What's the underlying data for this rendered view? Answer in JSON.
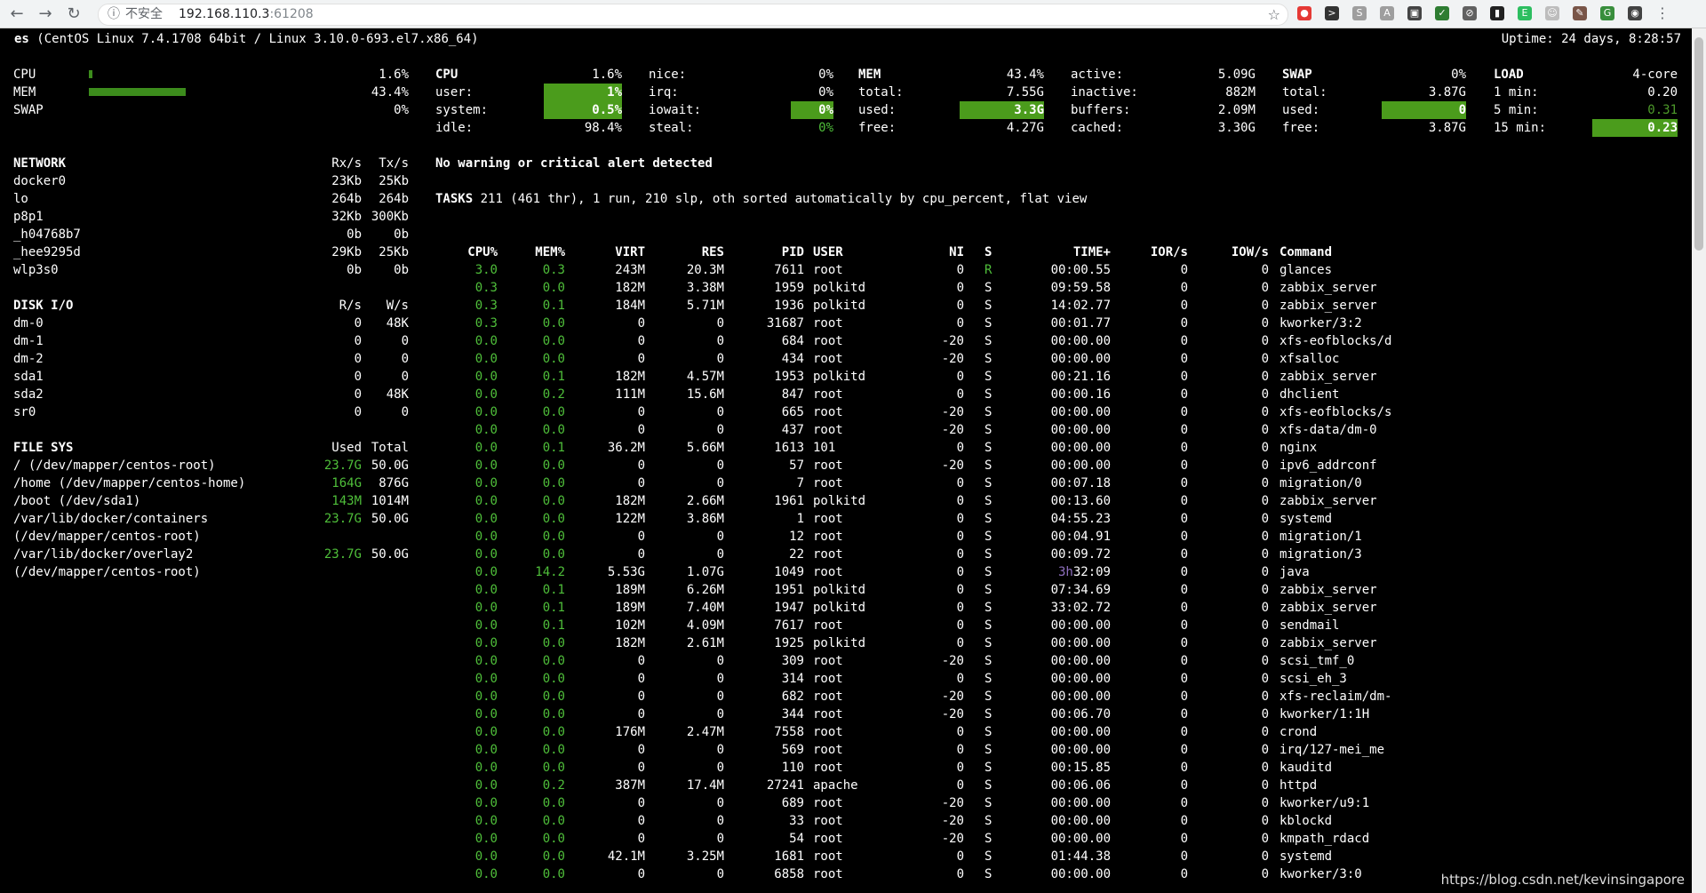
{
  "browser": {
    "back": "←",
    "forward": "→",
    "reload": "↻",
    "security_icon": "ⓘ",
    "security_text": "不安全",
    "url_host": "192.168.110.3",
    "url_port": ":61208",
    "star": "☆",
    "extensions": [
      {
        "icon": "stop-icon",
        "color": "#e53935",
        "glyph": "●"
      },
      {
        "icon": "terminal-icon",
        "color": "#333333",
        "glyph": ">"
      },
      {
        "icon": "s-icon",
        "color": "#9e9e9e",
        "glyph": "S"
      },
      {
        "icon": "a-icon",
        "color": "#9e9e9e",
        "glyph": "A"
      },
      {
        "icon": "card-icon",
        "color": "#444444",
        "glyph": "▣"
      },
      {
        "icon": "shield-icon",
        "color": "#2e7d32",
        "glyph": "✓"
      },
      {
        "icon": "block-icon",
        "color": "#616161",
        "glyph": "⊘"
      },
      {
        "icon": "bookmark-icon",
        "color": "#212121",
        "glyph": "▮"
      },
      {
        "icon": "evernote-icon",
        "color": "#2dbe60",
        "glyph": "E"
      },
      {
        "icon": "face-icon",
        "color": "#bdbdbd",
        "glyph": "☺"
      },
      {
        "icon": "paint-icon",
        "color": "#795548",
        "glyph": "✎"
      },
      {
        "icon": "g-icon",
        "color": "#388e3c",
        "glyph": "G"
      },
      {
        "icon": "avatar-icon",
        "color": "#424242",
        "glyph": "◉"
      },
      {
        "icon": "menu-icon",
        "color": "#f1f3f4",
        "glyph": "⋮"
      }
    ]
  },
  "header": {
    "host": "es",
    "system": "(CentOS Linux 7.4.1708 64bit / Linux 3.10.0-693.el7.x86_64)",
    "uptime": "Uptime: 24 days, 8:28:57"
  },
  "quicklook": {
    "rows": [
      {
        "label": "CPU",
        "value": "1.6%",
        "fraction": 0.016
      },
      {
        "label": "MEM",
        "value": "43.4%",
        "fraction": 0.434
      },
      {
        "label": "SWAP",
        "value": "0%",
        "fraction": 0
      }
    ]
  },
  "cpu": {
    "title": "CPU",
    "total": "1.6%",
    "rows": [
      {
        "label": "user:",
        "value": "1%"
      },
      {
        "label": "system:",
        "value": "0.5%"
      },
      {
        "label": "idle:",
        "value": "98.4%"
      }
    ],
    "rows2": [
      {
        "label": "nice:",
        "value": "0%"
      },
      {
        "label": "irq:",
        "value": "0%"
      },
      {
        "label": "iowait:",
        "value": "0%"
      },
      {
        "label": "steal:",
        "value": "0%"
      }
    ]
  },
  "mem": {
    "title": "MEM",
    "total_pct": "43.4%",
    "rows": [
      {
        "label": "total:",
        "value": "7.55G"
      },
      {
        "label": "used:",
        "value": "3.3G"
      },
      {
        "label": "free:",
        "value": "4.27G"
      }
    ],
    "rows2": [
      {
        "label": "active:",
        "value": "5.09G"
      },
      {
        "label": "inactive:",
        "value": "882M"
      },
      {
        "label": "buffers:",
        "value": "2.09M"
      },
      {
        "label": "cached:",
        "value": "3.30G"
      }
    ]
  },
  "swap": {
    "title": "SWAP",
    "pct": "0%",
    "rows": [
      {
        "label": "total:",
        "value": "3.87G"
      },
      {
        "label": "used:",
        "value": "0"
      },
      {
        "label": "free:",
        "value": "3.87G"
      }
    ]
  },
  "load": {
    "title": "LOAD",
    "cores": "4-core",
    "rows": [
      {
        "label": "1 min:",
        "value": "0.20"
      },
      {
        "label": "5 min:",
        "value": "0.31"
      },
      {
        "label": "15 min:",
        "value": "0.23"
      }
    ]
  },
  "network": {
    "title": "NETWORK",
    "rx": "Rx/s",
    "tx": "Tx/s",
    "rows": [
      {
        "name": "docker0",
        "rx": "23Kb",
        "tx": "25Kb"
      },
      {
        "name": "lo",
        "rx": "264b",
        "tx": "264b"
      },
      {
        "name": "p8p1",
        "rx": "32Kb",
        "tx": "300Kb"
      },
      {
        "name": "_h04768b7",
        "rx": "0b",
        "tx": "0b"
      },
      {
        "name": "_hee9295d",
        "rx": "29Kb",
        "tx": "25Kb"
      },
      {
        "name": "wlp3s0",
        "rx": "0b",
        "tx": "0b"
      }
    ]
  },
  "diskio": {
    "title": "DISK I/O",
    "r": "R/s",
    "w": "W/s",
    "rows": [
      {
        "name": "dm-0",
        "r": "0",
        "w": "48K"
      },
      {
        "name": "dm-1",
        "r": "0",
        "w": "0"
      },
      {
        "name": "dm-2",
        "r": "0",
        "w": "0"
      },
      {
        "name": "sda1",
        "r": "0",
        "w": "0"
      },
      {
        "name": "sda2",
        "r": "0",
        "w": "48K"
      },
      {
        "name": "sr0",
        "r": "0",
        "w": "0"
      }
    ]
  },
  "filesys": {
    "title": "FILE SYS",
    "used": "Used",
    "total": "Total",
    "rows": [
      {
        "name": "/ (/dev/mapper/centos-root)",
        "used": "23.7G",
        "total": "50.0G"
      },
      {
        "name": "/home (/dev/mapper/centos-home)",
        "used": "164G",
        "total": "876G"
      },
      {
        "name": "/boot (/dev/sda1)",
        "used": "143M",
        "total": "1014M"
      },
      {
        "name": "/var/lib/docker/containers",
        "used": "23.7G",
        "total": "50.0G"
      },
      {
        "name": "(/dev/mapper/centos-root)",
        "used": "",
        "total": ""
      },
      {
        "name": "/var/lib/docker/overlay2",
        "used": "23.7G",
        "total": "50.0G"
      },
      {
        "name": "(/dev/mapper/centos-root)",
        "used": "",
        "total": ""
      }
    ]
  },
  "alert": "No warning or critical alert detected",
  "tasks": {
    "label": "TASKS",
    "summary": "211 (461 thr), 1 run, 210 slp, oth sorted automatically by cpu_percent, flat view"
  },
  "processes": {
    "headers": [
      "CPU%",
      "MEM%",
      "VIRT",
      "RES",
      "PID",
      "USER",
      "NI",
      "S",
      "TIME+",
      "IOR/s",
      "IOW/s",
      "Command"
    ],
    "rows": [
      [
        "3.0",
        "0.3",
        "243M",
        "20.3M",
        "7611",
        "root",
        "0",
        "R",
        "00:00.55",
        "0",
        "0",
        "glances"
      ],
      [
        "0.3",
        "0.0",
        "182M",
        "3.38M",
        "1959",
        "polkitd",
        "0",
        "S",
        "09:59.58",
        "0",
        "0",
        "zabbix_server"
      ],
      [
        "0.3",
        "0.1",
        "184M",
        "5.71M",
        "1936",
        "polkitd",
        "0",
        "S",
        "14:02.77",
        "0",
        "0",
        "zabbix_server"
      ],
      [
        "0.3",
        "0.0",
        "0",
        "0",
        "31687",
        "root",
        "0",
        "S",
        "00:01.77",
        "0",
        "0",
        "kworker/3:2"
      ],
      [
        "0.0",
        "0.0",
        "0",
        "0",
        "684",
        "root",
        "-20",
        "S",
        "00:00.00",
        "0",
        "0",
        "xfs-eofblocks/d"
      ],
      [
        "0.0",
        "0.0",
        "0",
        "0",
        "434",
        "root",
        "-20",
        "S",
        "00:00.00",
        "0",
        "0",
        "xfsalloc"
      ],
      [
        "0.0",
        "0.1",
        "182M",
        "4.57M",
        "1953",
        "polkitd",
        "0",
        "S",
        "00:21.16",
        "0",
        "0",
        "zabbix_server"
      ],
      [
        "0.0",
        "0.2",
        "111M",
        "15.6M",
        "847",
        "root",
        "0",
        "S",
        "00:00.16",
        "0",
        "0",
        "dhclient"
      ],
      [
        "0.0",
        "0.0",
        "0",
        "0",
        "665",
        "root",
        "-20",
        "S",
        "00:00.00",
        "0",
        "0",
        "xfs-eofblocks/s"
      ],
      [
        "0.0",
        "0.0",
        "0",
        "0",
        "437",
        "root",
        "-20",
        "S",
        "00:00.00",
        "0",
        "0",
        "xfs-data/dm-0"
      ],
      [
        "0.0",
        "0.1",
        "36.2M",
        "5.66M",
        "1613",
        "101",
        "0",
        "S",
        "00:00.00",
        "0",
        "0",
        "nginx"
      ],
      [
        "0.0",
        "0.0",
        "0",
        "0",
        "57",
        "root",
        "-20",
        "S",
        "00:00.00",
        "0",
        "0",
        "ipv6_addrconf"
      ],
      [
        "0.0",
        "0.0",
        "0",
        "0",
        "7",
        "root",
        "0",
        "S",
        "00:07.18",
        "0",
        "0",
        "migration/0"
      ],
      [
        "0.0",
        "0.0",
        "182M",
        "2.66M",
        "1961",
        "polkitd",
        "0",
        "S",
        "00:13.60",
        "0",
        "0",
        "zabbix_server"
      ],
      [
        "0.0",
        "0.0",
        "122M",
        "3.86M",
        "1",
        "root",
        "0",
        "S",
        "04:55.23",
        "0",
        "0",
        "systemd"
      ],
      [
        "0.0",
        "0.0",
        "0",
        "0",
        "12",
        "root",
        "0",
        "S",
        "00:04.91",
        "0",
        "0",
        "migration/1"
      ],
      [
        "0.0",
        "0.0",
        "0",
        "0",
        "22",
        "root",
        "0",
        "S",
        "00:09.72",
        "0",
        "0",
        "migration/3"
      ],
      [
        "0.0",
        "14.2",
        "5.53G",
        "1.07G",
        "1049",
        "root",
        "0",
        "S",
        "3h32:09",
        "0",
        "0",
        "java"
      ],
      [
        "0.0",
        "0.1",
        "189M",
        "6.26M",
        "1951",
        "polkitd",
        "0",
        "S",
        "07:34.69",
        "0",
        "0",
        "zabbix_server"
      ],
      [
        "0.0",
        "0.1",
        "189M",
        "7.40M",
        "1947",
        "polkitd",
        "0",
        "S",
        "33:02.72",
        "0",
        "0",
        "zabbix_server"
      ],
      [
        "0.0",
        "0.1",
        "102M",
        "4.09M",
        "7617",
        "root",
        "0",
        "S",
        "00:00.00",
        "0",
        "0",
        "sendmail"
      ],
      [
        "0.0",
        "0.0",
        "182M",
        "2.61M",
        "1925",
        "polkitd",
        "0",
        "S",
        "00:00.00",
        "0",
        "0",
        "zabbix_server"
      ],
      [
        "0.0",
        "0.0",
        "0",
        "0",
        "309",
        "root",
        "-20",
        "S",
        "00:00.00",
        "0",
        "0",
        "scsi_tmf_0"
      ],
      [
        "0.0",
        "0.0",
        "0",
        "0",
        "314",
        "root",
        "0",
        "S",
        "00:00.00",
        "0",
        "0",
        "scsi_eh_3"
      ],
      [
        "0.0",
        "0.0",
        "0",
        "0",
        "682",
        "root",
        "-20",
        "S",
        "00:00.00",
        "0",
        "0",
        "xfs-reclaim/dm-"
      ],
      [
        "0.0",
        "0.0",
        "0",
        "0",
        "344",
        "root",
        "-20",
        "S",
        "00:06.70",
        "0",
        "0",
        "kworker/1:1H"
      ],
      [
        "0.0",
        "0.0",
        "176M",
        "2.47M",
        "7558",
        "root",
        "0",
        "S",
        "00:00.00",
        "0",
        "0",
        "crond"
      ],
      [
        "0.0",
        "0.0",
        "0",
        "0",
        "569",
        "root",
        "0",
        "S",
        "00:00.00",
        "0",
        "0",
        "irq/127-mei_me"
      ],
      [
        "0.0",
        "0.0",
        "0",
        "0",
        "110",
        "root",
        "0",
        "S",
        "00:15.85",
        "0",
        "0",
        "kauditd"
      ],
      [
        "0.0",
        "0.2",
        "387M",
        "17.4M",
        "27241",
        "apache",
        "0",
        "S",
        "00:06.06",
        "0",
        "0",
        "httpd"
      ],
      [
        "0.0",
        "0.0",
        "0",
        "0",
        "689",
        "root",
        "-20",
        "S",
        "00:00.00",
        "0",
        "0",
        "kworker/u9:1"
      ],
      [
        "0.0",
        "0.0",
        "0",
        "0",
        "33",
        "root",
        "-20",
        "S",
        "00:00.00",
        "0",
        "0",
        "kblockd"
      ],
      [
        "0.0",
        "0.0",
        "0",
        "0",
        "54",
        "root",
        "-20",
        "S",
        "00:00.00",
        "0",
        "0",
        "kmpath_rdacd"
      ],
      [
        "0.0",
        "0.0",
        "42.1M",
        "3.25M",
        "1681",
        "root",
        "0",
        "S",
        "01:44.38",
        "0",
        "0",
        "systemd"
      ],
      [
        "0.0",
        "0.0",
        "0",
        "0",
        "6858",
        "root",
        "0",
        "S",
        "00:00.00",
        "0",
        "0",
        "kworker/3:0"
      ]
    ]
  },
  "watermark": "https://blog.csdn.net/kevinsingapore"
}
